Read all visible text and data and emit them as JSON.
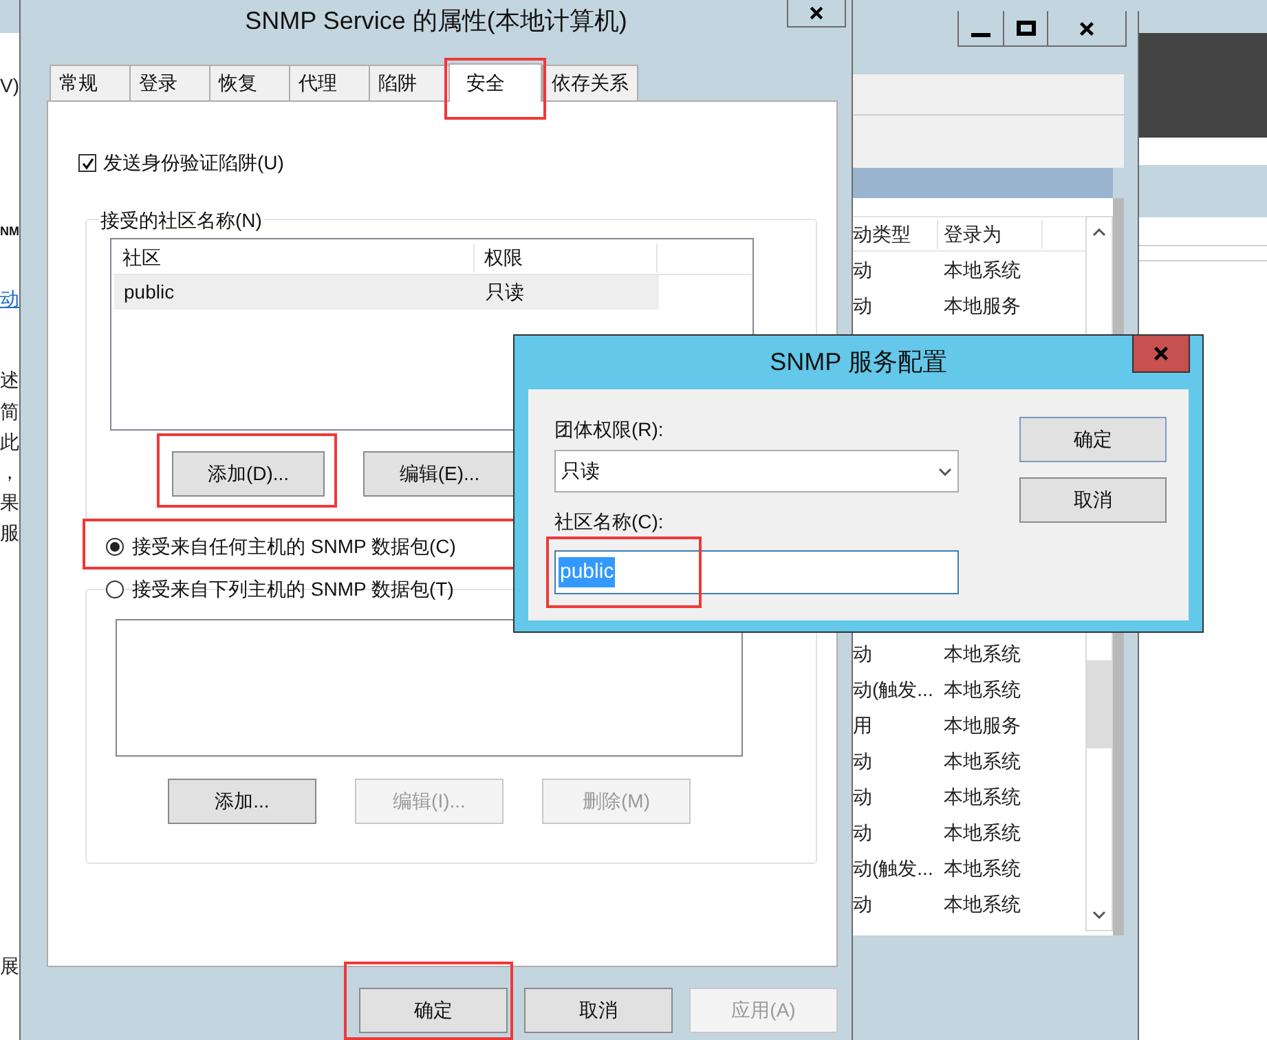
{
  "background_fragments": [
    {
      "text": "V)",
      "kind": "plain"
    },
    {
      "text": "NM",
      "kind": "bold"
    },
    {
      "text": "动",
      "kind": "link"
    },
    {
      "text": "述",
      "kind": "plain"
    },
    {
      "text": "简",
      "kind": "plain"
    },
    {
      "text": "此",
      "kind": "plain"
    },
    {
      "text": "，",
      "kind": "plain"
    },
    {
      "text": "果",
      "kind": "plain"
    },
    {
      "text": "服",
      "kind": "plain"
    },
    {
      "text": "展",
      "kind": "plain"
    }
  ],
  "services_window": {
    "columns": [
      "动类型",
      "登录为"
    ],
    "rows_top": [
      {
        "cells": [
          "动",
          "本地系统"
        ]
      },
      {
        "cells": [
          "动",
          "本地服务"
        ]
      }
    ],
    "rows_bottom": [
      {
        "cells": [
          "动",
          "本地系统"
        ]
      },
      {
        "cells": [
          "动(触发...",
          "本地系统"
        ]
      },
      {
        "cells": [
          "用",
          "本地服务"
        ]
      },
      {
        "cells": [
          "动",
          "本地系统"
        ]
      },
      {
        "cells": [
          "动",
          "本地系统"
        ]
      },
      {
        "cells": [
          "动",
          "本地系统"
        ]
      },
      {
        "cells": [
          "动(触发...",
          "本地系统"
        ]
      },
      {
        "cells": [
          "动",
          "本地系统"
        ]
      }
    ]
  },
  "properties_dialog": {
    "title": "SNMP Service 的属性(本地计算机)",
    "tabs": [
      {
        "label": "常规",
        "selected": false,
        "highlighted": false
      },
      {
        "label": "登录",
        "selected": false,
        "highlighted": false
      },
      {
        "label": "恢复",
        "selected": false,
        "highlighted": false
      },
      {
        "label": "代理",
        "selected": false,
        "highlighted": false
      },
      {
        "label": "陷阱",
        "selected": false,
        "highlighted": false
      },
      {
        "label": "安全",
        "selected": true,
        "highlighted": true
      },
      {
        "label": "依存关系",
        "selected": false,
        "highlighted": false
      }
    ],
    "send_auth_trap": {
      "label": "发送身份验证陷阱(U)",
      "checked": true
    },
    "community_group": {
      "title": "接受的社区名称(N)",
      "columns": [
        "社区",
        "权限"
      ],
      "rows": [
        {
          "cells": [
            "public",
            "只读"
          ],
          "selected": true
        }
      ],
      "buttons": [
        {
          "label": "添加(D)...",
          "disabled": false,
          "highlighted": true
        },
        {
          "label": "编辑(E)...",
          "disabled": false,
          "highlighted": false
        }
      ]
    },
    "host_options": [
      {
        "label": "接受来自任何主机的 SNMP 数据包(C)",
        "selected": true,
        "highlighted": true
      },
      {
        "label": "接受来自下列主机的 SNMP 数据包(T)",
        "selected": false,
        "highlighted": false
      }
    ],
    "host_buttons": [
      {
        "label": "添加...",
        "disabled": false,
        "highlighted": false
      },
      {
        "label": "编辑(I)...",
        "disabled": true,
        "highlighted": false
      },
      {
        "label": "删除(M)",
        "disabled": true,
        "highlighted": false
      }
    ],
    "footer_buttons": [
      {
        "label": "确定",
        "disabled": false,
        "highlighted": true
      },
      {
        "label": "取消",
        "disabled": false,
        "highlighted": false
      },
      {
        "label": "应用(A)",
        "disabled": true,
        "highlighted": false
      }
    ]
  },
  "config_dialog": {
    "title": "SNMP 服务配置",
    "rights_label": "团体权限(R):",
    "rights_value": "只读",
    "name_label": "社区名称(C):",
    "name_value": "public",
    "name_selected": true,
    "name_highlighted": true,
    "buttons": [
      {
        "label": "确定",
        "disabled": false,
        "highlighted": false
      },
      {
        "label": "取消",
        "disabled": false,
        "highlighted": false
      }
    ]
  }
}
